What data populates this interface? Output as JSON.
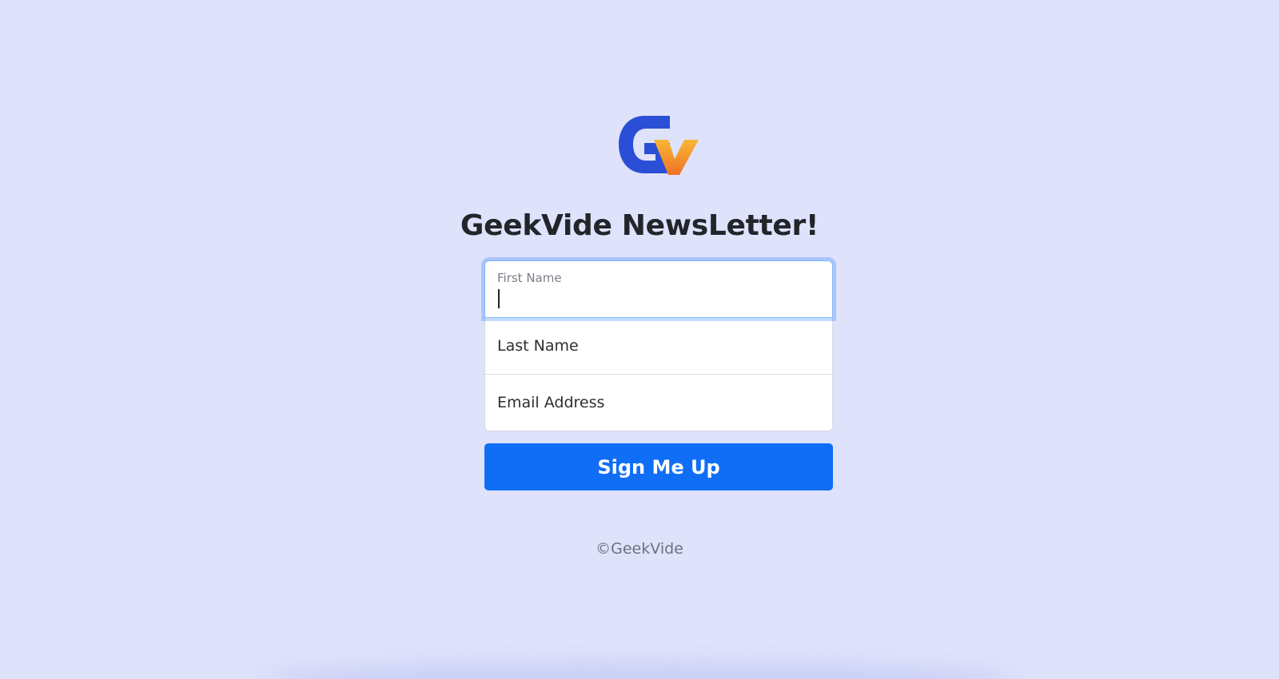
{
  "brand": {
    "logo_icon": "geekvide-logo-icon",
    "logo_colors": {
      "g": "#2a4fd6",
      "v_top": "#f5a623",
      "v_bottom": "#f0772a"
    }
  },
  "heading": "GeekVide NewsLetter!",
  "form": {
    "first_name": {
      "label": "First Name",
      "value": ""
    },
    "last_name": {
      "label": "Last Name",
      "value": ""
    },
    "email": {
      "label": "Email Address",
      "value": ""
    },
    "submit_label": "Sign Me Up"
  },
  "footer": {
    "copyright": "©GeekVide"
  },
  "colors": {
    "background": "#dee2fb",
    "primary": "#106ef6",
    "focus_border": "#86b7fe"
  }
}
